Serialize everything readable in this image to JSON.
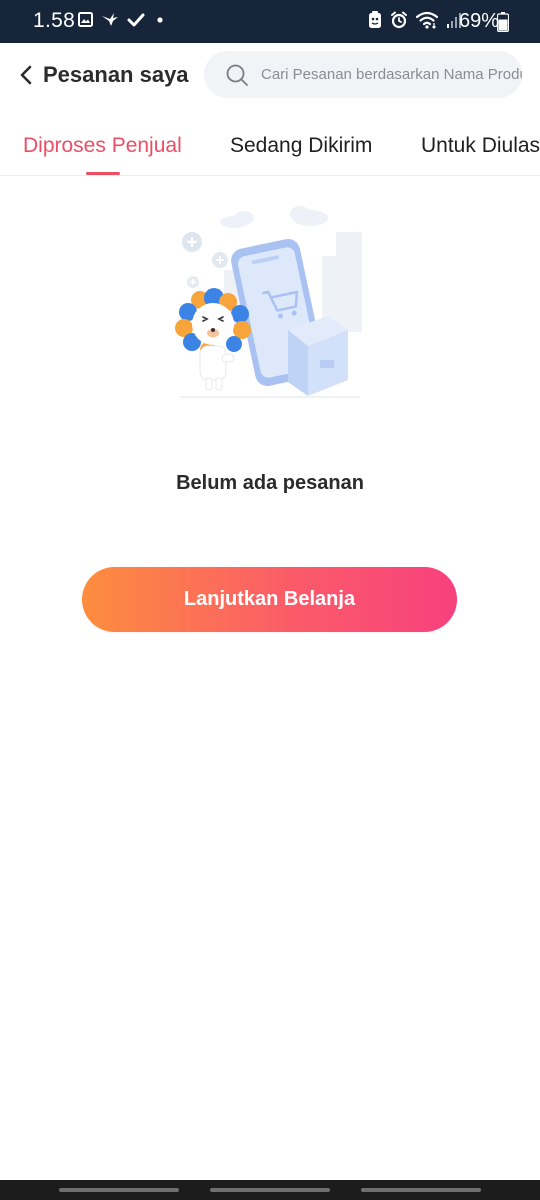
{
  "status_bar": {
    "time": "1.58",
    "battery": "69%",
    "left_icons": [
      "gallery-icon",
      "bird-icon",
      "check-icon",
      "dot-icon"
    ],
    "right_icons": [
      "sim-icon",
      "alarm-icon",
      "wifi-icon",
      "signal-icon",
      "battery-icon"
    ]
  },
  "header": {
    "title": "Pesanan saya",
    "search_placeholder": "Cari Pesanan berdasarkan Nama Produk"
  },
  "tabs": [
    {
      "label": "Diproses Penjual",
      "active": true
    },
    {
      "label": "Sedang Dikirim",
      "active": false
    },
    {
      "label": "Untuk Diulas",
      "active": false
    }
  ],
  "empty_state": {
    "message": "Belum ada pesanan",
    "button_label": "Lanjutkan Belanja"
  },
  "colors": {
    "accent": "#ea4f65",
    "status_bar": "#16253a",
    "gradient_start": "#fd8d3e",
    "gradient_end": "#f7407e"
  }
}
